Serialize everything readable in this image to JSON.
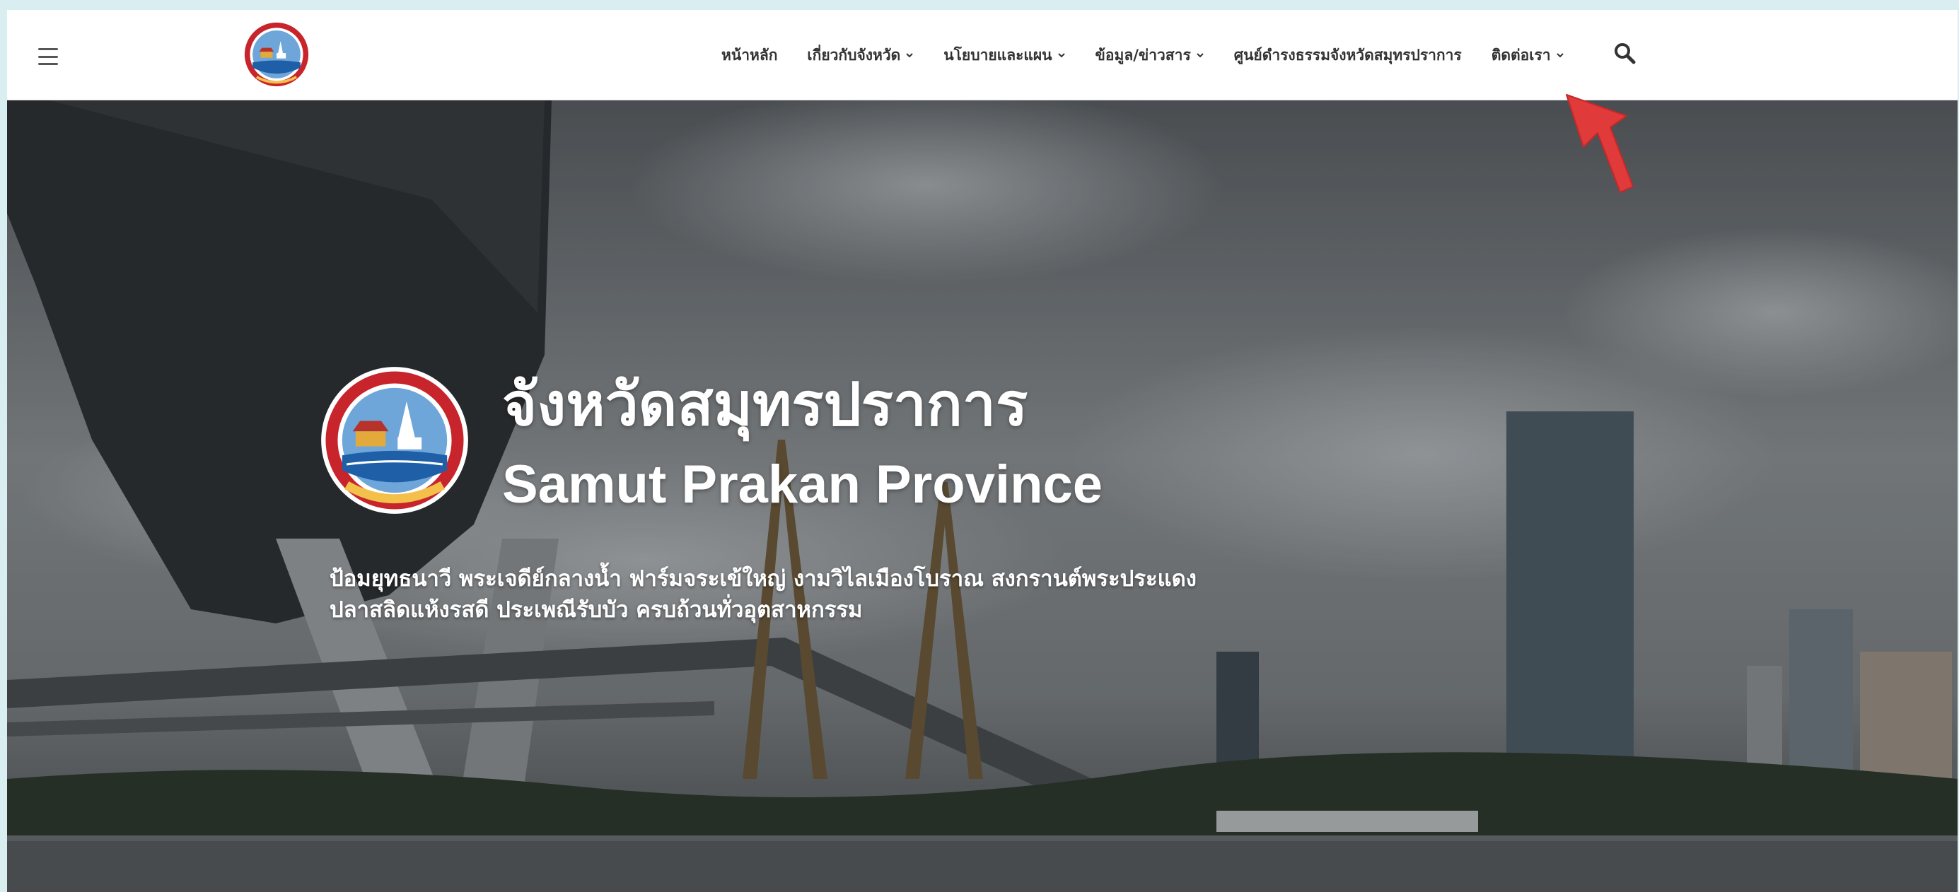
{
  "nav": {
    "items": [
      {
        "label": "หน้าหลัก",
        "has_dropdown": false
      },
      {
        "label": "เกี่ยวกับจังหวัด",
        "has_dropdown": true
      },
      {
        "label": "นโยบายและแผน",
        "has_dropdown": true
      },
      {
        "label": "ข้อมูล/ข่าวสาร",
        "has_dropdown": true
      },
      {
        "label": "ศูนย์ดำรงธรรมจังหวัดสมุทรปราการ",
        "has_dropdown": false
      },
      {
        "label": "ติดต่อเรา",
        "has_dropdown": true
      }
    ],
    "icons": {
      "menu": "hamburger-icon",
      "search": "search-icon",
      "dropdown": "chevron-down-icon"
    }
  },
  "hero": {
    "title_th": "จังหวัดสมุทรปราการ",
    "title_en": "Samut Prakan Province",
    "tagline_line1": "ป้อมยุทธนาวี พระเจดีย์กลางน้ำ ฟาร์มจระเข้ใหญ่ งามวิไลเมืองโบราณ สงกรานต์พระประแดง",
    "tagline_line2": "ปลาสลิดแห้งรสดี ประเพณีรับบัว ครบถ้วนทั่วอุตสาหกรรม"
  },
  "colors": {
    "accent_red": "#e03a3a",
    "seal_red": "#c8242c",
    "seal_blue": "#1e5fa8",
    "nav_text": "#333333"
  }
}
